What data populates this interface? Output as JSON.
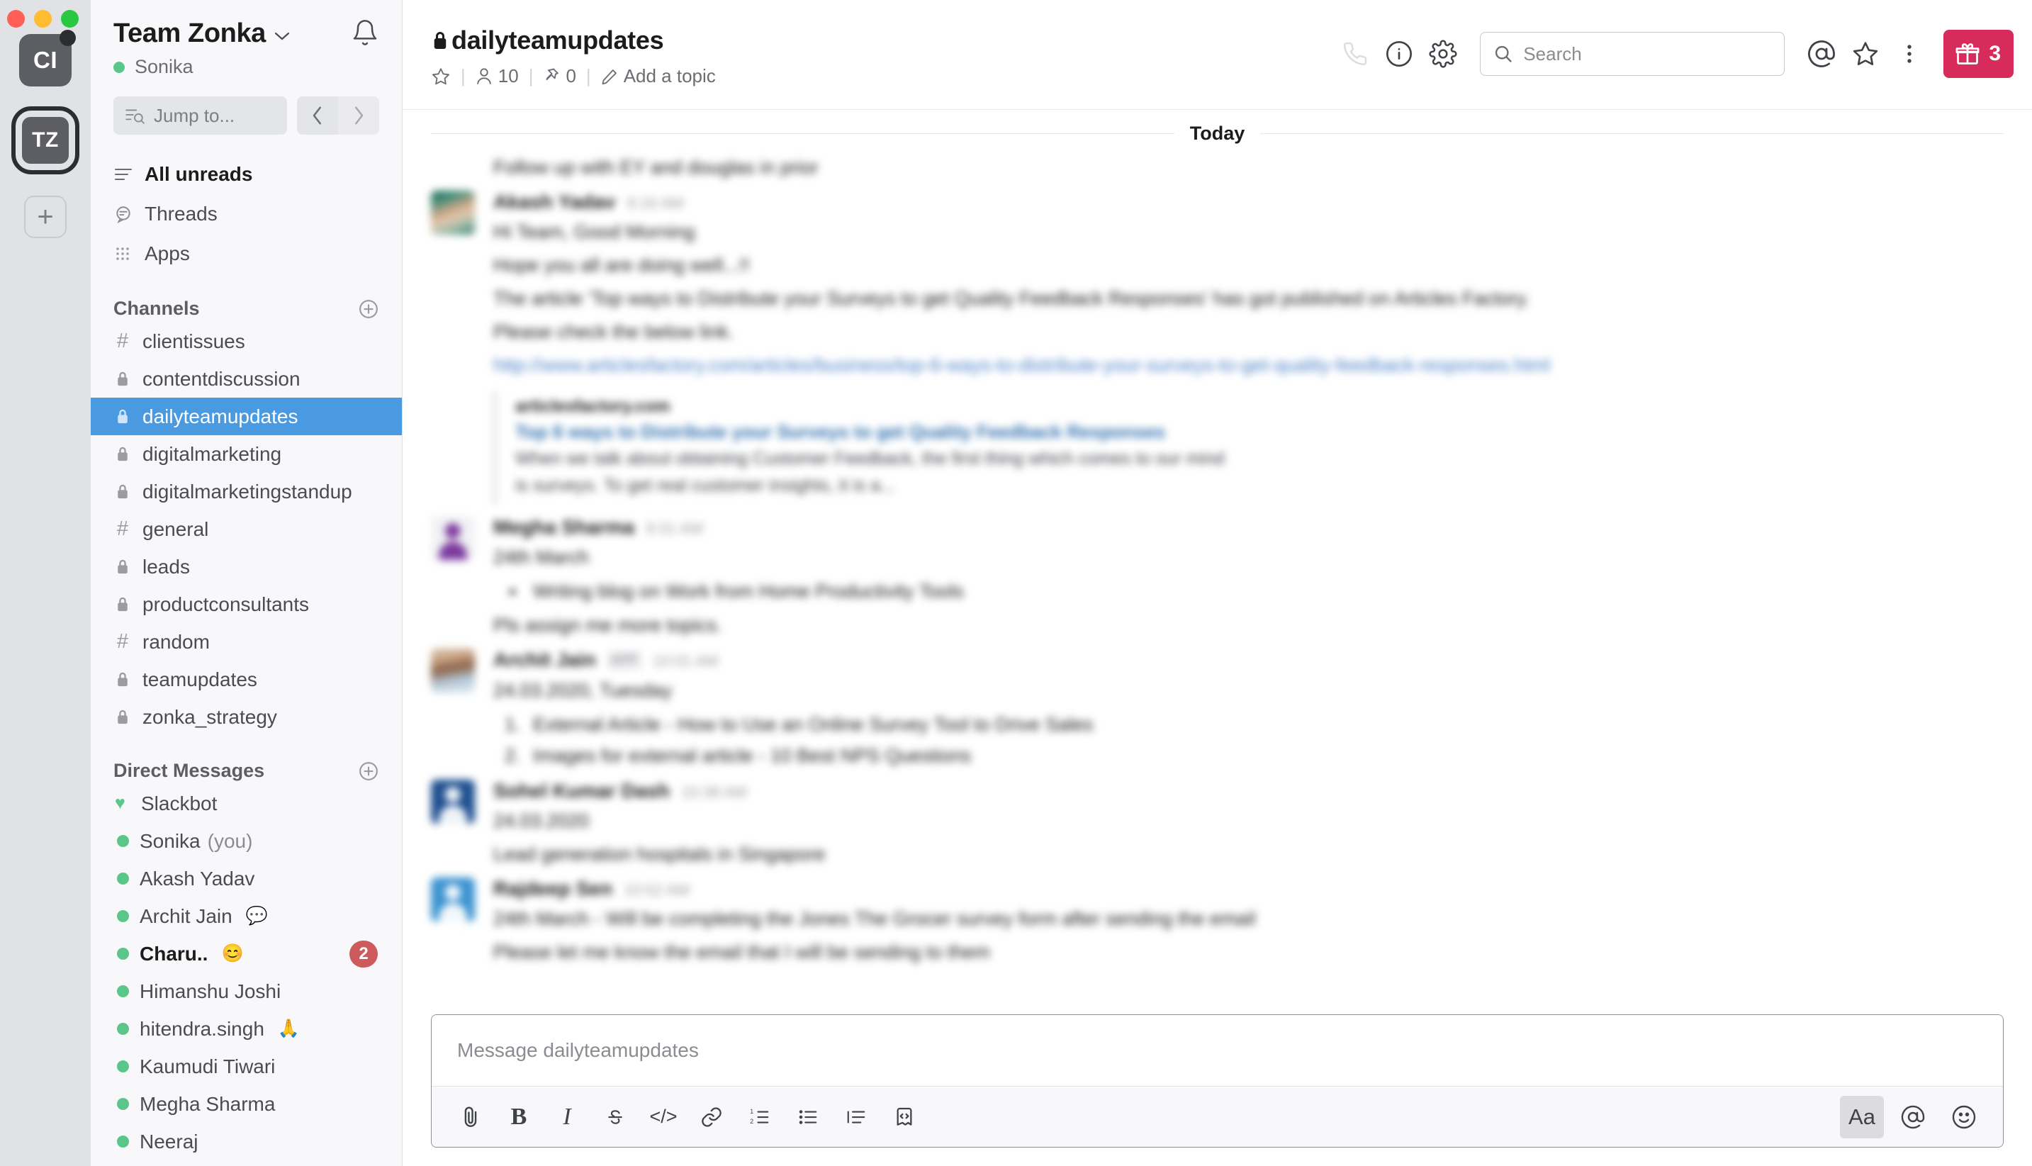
{
  "window": {
    "traffic_lights": [
      "close",
      "minimize",
      "maximize"
    ]
  },
  "workspaces": [
    {
      "initials": "CI",
      "has_unread_dot": true,
      "active": false
    },
    {
      "initials": "TZ",
      "has_unread_dot": false,
      "active": true
    }
  ],
  "workspace_add_label": "+",
  "sidebar": {
    "team_name": "Team Zonka",
    "team_chevron": "⌄",
    "user_name": "Sonika",
    "jump_placeholder": "Jump to...",
    "nav_prev": "‹",
    "nav_next": "›",
    "quick_links": [
      {
        "label": "All unreads",
        "icon": "unreads-icon",
        "bold": true
      },
      {
        "label": "Threads",
        "icon": "threads-icon",
        "bold": false
      },
      {
        "label": "Apps",
        "icon": "apps-grid-icon",
        "bold": false
      }
    ],
    "channels_header": "Channels",
    "channels": [
      {
        "name": "clientissues",
        "type": "public",
        "selected": false
      },
      {
        "name": "contentdiscussion",
        "type": "private",
        "selected": false
      },
      {
        "name": "dailyteamupdates",
        "type": "private",
        "selected": true
      },
      {
        "name": "digitalmarketing",
        "type": "private",
        "selected": false
      },
      {
        "name": "digitalmarketingstandup",
        "type": "private",
        "selected": false
      },
      {
        "name": "general",
        "type": "public",
        "selected": false
      },
      {
        "name": "leads",
        "type": "private",
        "selected": false
      },
      {
        "name": "productconsultants",
        "type": "private",
        "selected": false
      },
      {
        "name": "random",
        "type": "public",
        "selected": false
      },
      {
        "name": "teamupdates",
        "type": "private",
        "selected": false
      },
      {
        "name": "zonka_strategy",
        "type": "private",
        "selected": false
      }
    ],
    "dms_header": "Direct Messages",
    "dms": [
      {
        "name": "Slackbot",
        "presence": "heart",
        "suffix": "",
        "emoji": "",
        "unread": 0,
        "bold": false
      },
      {
        "name": "Sonika",
        "presence": "online",
        "suffix": "(you)",
        "emoji": "",
        "unread": 0,
        "bold": false
      },
      {
        "name": "Akash Yadav",
        "presence": "online",
        "suffix": "",
        "emoji": "",
        "unread": 0,
        "bold": false
      },
      {
        "name": "Archit Jain",
        "presence": "online",
        "suffix": "",
        "emoji": "💬",
        "unread": 0,
        "bold": false
      },
      {
        "name": "Charu..",
        "presence": "online",
        "suffix": "",
        "emoji": "😊",
        "unread": 2,
        "bold": true
      },
      {
        "name": "Himanshu Joshi",
        "presence": "online",
        "suffix": "",
        "emoji": "",
        "unread": 0,
        "bold": false
      },
      {
        "name": "hitendra.singh",
        "presence": "online",
        "suffix": "",
        "emoji": "🙏",
        "unread": 0,
        "bold": false
      },
      {
        "name": "Kaumudi Tiwari",
        "presence": "online",
        "suffix": "",
        "emoji": "",
        "unread": 0,
        "bold": false
      },
      {
        "name": "Megha Sharma",
        "presence": "online",
        "suffix": "",
        "emoji": "",
        "unread": 0,
        "bold": false
      },
      {
        "name": "Neeraj",
        "presence": "online",
        "suffix": "",
        "emoji": "",
        "unread": 0,
        "bold": false
      }
    ]
  },
  "channel_header": {
    "name": "dailyteamupdates",
    "is_private": true,
    "star_label": "☆",
    "members_count": "10",
    "pins_count": "0",
    "topic_label": "Add a topic",
    "icons": [
      "call-icon",
      "info-icon",
      "gear-icon"
    ],
    "search_placeholder": "Search",
    "right_icons": [
      "mentions-at-icon",
      "star-icon",
      "more-vertical-icon"
    ],
    "gift_count": "3",
    "accent_gift": "#d62b5b",
    "accent_selected": "#4a9ae1",
    "accent_badge": "#cd5b5b"
  },
  "messages": {
    "day_divider": "Today",
    "items": [
      {
        "id": "m0",
        "author": "",
        "time": "",
        "avatar": "none",
        "continuation": true,
        "lines": [
          "Follow up with EY and douglas in prior"
        ]
      },
      {
        "id": "m1",
        "author": "Akash Yadav",
        "time": "9:16 AM",
        "avatar": "photo",
        "continuation": false,
        "lines": [
          "Hi Team, Good Morning",
          "Hope you all are doing well...!!",
          "The article 'Top ways to Distribute your Surveys to get Quality Feedback Responses' has got published on Articles Factory.",
          "Please check the below link."
        ],
        "link": "http://www.articlesfactory.com/articles/business/top-6-ways-to-distribute-your-surveys-to-get-quality-feedback-responses.html",
        "attachment": {
          "site": "articlesfactory.com",
          "title": "Top 6 ways to Distribute your Surveys to get Quality Feedback Responses",
          "description": "When we talk about obtaining Customer Feedback, the first thing which comes to our mind is surveys. To get real customer insights, it is a..."
        }
      },
      {
        "id": "m2",
        "author": "Megha Sharma",
        "time": "9:31 AM",
        "avatar": "person-purple",
        "continuation": false,
        "lines": [
          "24th March"
        ],
        "bullets": [
          "Writing blog on Work from Home Productivity Tools"
        ],
        "trailing_lines": [
          "Pls assign me more topics."
        ]
      },
      {
        "id": "m3",
        "author": "Archit Jain",
        "time": "10:01 AM",
        "badge": "APP",
        "avatar": "face",
        "continuation": false,
        "lines": [
          "24.03.2020, Tuesday"
        ],
        "ordered": [
          "External Article - How to Use an Online Survey Tool to Drive Sales",
          "Images for external article - 10 Best NPS Questions"
        ]
      },
      {
        "id": "m4",
        "author": "Sohel Kumar Dash",
        "time": "10:38 AM",
        "avatar": "person-blue-dark",
        "continuation": false,
        "lines": [
          "24.03.2020",
          "Lead generation hospitals in Singapore"
        ]
      },
      {
        "id": "m5",
        "author": "Rajdeep Sen",
        "time": "10:52 AM",
        "avatar": "person-blue-light",
        "continuation": false,
        "lines": [
          "24th March - Will be completing the Jones The Grocer survey form after sending the email",
          "Please let me know the email that I will be sending to them"
        ]
      }
    ]
  },
  "composer": {
    "placeholder": "Message dailyteamupdates",
    "tools": [
      {
        "name": "attach-icon",
        "glyph": ""
      },
      {
        "name": "bold-button",
        "glyph": "B"
      },
      {
        "name": "italic-button",
        "glyph": "I"
      },
      {
        "name": "strikethrough-button",
        "glyph": "S"
      },
      {
        "name": "code-button",
        "glyph": "</>"
      },
      {
        "name": "link-button",
        "glyph": ""
      },
      {
        "name": "ordered-list-button",
        "glyph": ""
      },
      {
        "name": "bulleted-list-button",
        "glyph": ""
      },
      {
        "name": "blockquote-button",
        "glyph": ""
      },
      {
        "name": "code-block-button",
        "glyph": ""
      }
    ],
    "right_tools": [
      {
        "name": "formatting-toggle",
        "glyph": "Aa",
        "active": true
      },
      {
        "name": "mention-button",
        "glyph": "@",
        "active": false
      },
      {
        "name": "emoji-button",
        "glyph": "☺",
        "active": false
      }
    ]
  }
}
